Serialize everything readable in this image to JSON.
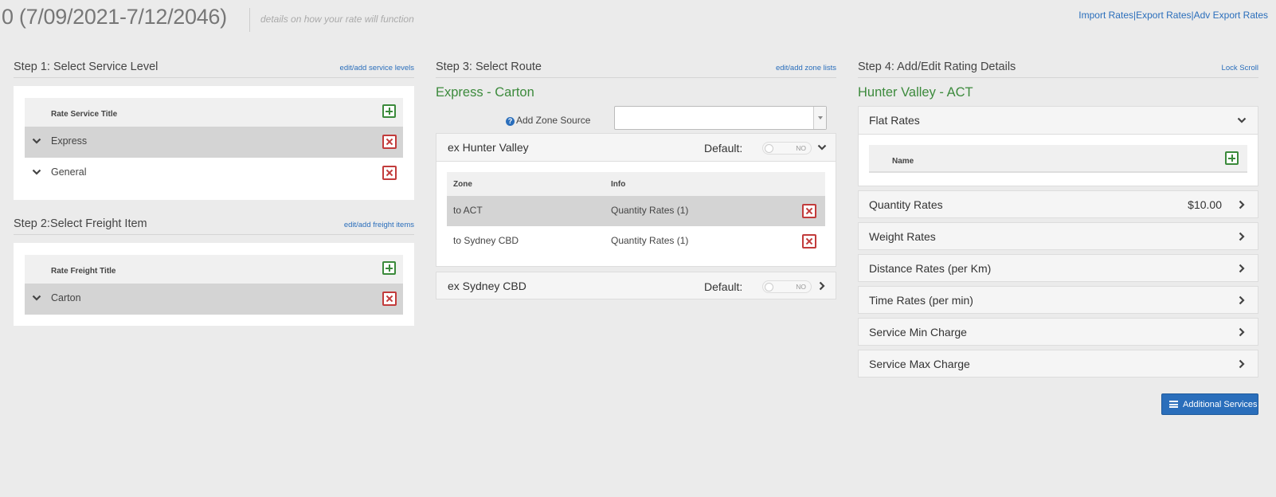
{
  "header": {
    "title": "0 (7/09/2021-7/12/2046)",
    "subtitle": "details on how your rate will function",
    "links": [
      "Import Rates",
      "Export Rates",
      "Adv Export Rates"
    ],
    "link_separator": "|"
  },
  "step1": {
    "title": "Step 1: Select Service Level",
    "link": "edit/add service levels",
    "column_header": "Rate Service Title",
    "rows": [
      {
        "label": "Express",
        "selected": true
      },
      {
        "label": "General",
        "selected": false
      }
    ]
  },
  "step2": {
    "title": "Step 2:Select Freight Item",
    "link": "edit/add freight items",
    "column_header": "Rate Freight Title",
    "rows": [
      {
        "label": "Carton",
        "selected": true
      }
    ]
  },
  "step3": {
    "title": "Step 3: Select Route",
    "link": "edit/add zone lists",
    "route_title": "Express - Carton",
    "add_zone_source_label": "Add Zone Source",
    "zone_source_value": "",
    "default_label": "Default:",
    "toggle_text": "NO",
    "zone_panels": [
      {
        "title": "ex Hunter Valley",
        "expanded": true,
        "columns": [
          "Zone",
          "Info"
        ],
        "rows": [
          {
            "zone": "to ACT",
            "info": "Quantity Rates (1)",
            "selected": true
          },
          {
            "zone": "to Sydney CBD",
            "info": "Quantity Rates (1)",
            "selected": false
          }
        ]
      },
      {
        "title": "ex Sydney CBD",
        "expanded": false
      }
    ]
  },
  "step4": {
    "title": "Step 4: Add/Edit Rating Details",
    "link": "Lock Scroll",
    "route_title": "Hunter Valley - ACT",
    "flat_rates": {
      "label": "Flat Rates",
      "column_header": "Name"
    },
    "rate_items": [
      {
        "label": "Quantity Rates",
        "value": "$10.00"
      },
      {
        "label": "Weight Rates",
        "value": ""
      },
      {
        "label": "Distance Rates (per Km)",
        "value": ""
      },
      {
        "label": "Time Rates (per min)",
        "value": ""
      },
      {
        "label": "Service Min Charge",
        "value": ""
      },
      {
        "label": "Service Max Charge",
        "value": ""
      }
    ],
    "additional_services_label": "Additional Services"
  },
  "colors": {
    "link": "#2a6ebb",
    "green_title": "#3c8a3c",
    "delete_red": "#c23b3b",
    "add_green": "#3b8a3b",
    "primary_button": "#2a6ebb"
  }
}
